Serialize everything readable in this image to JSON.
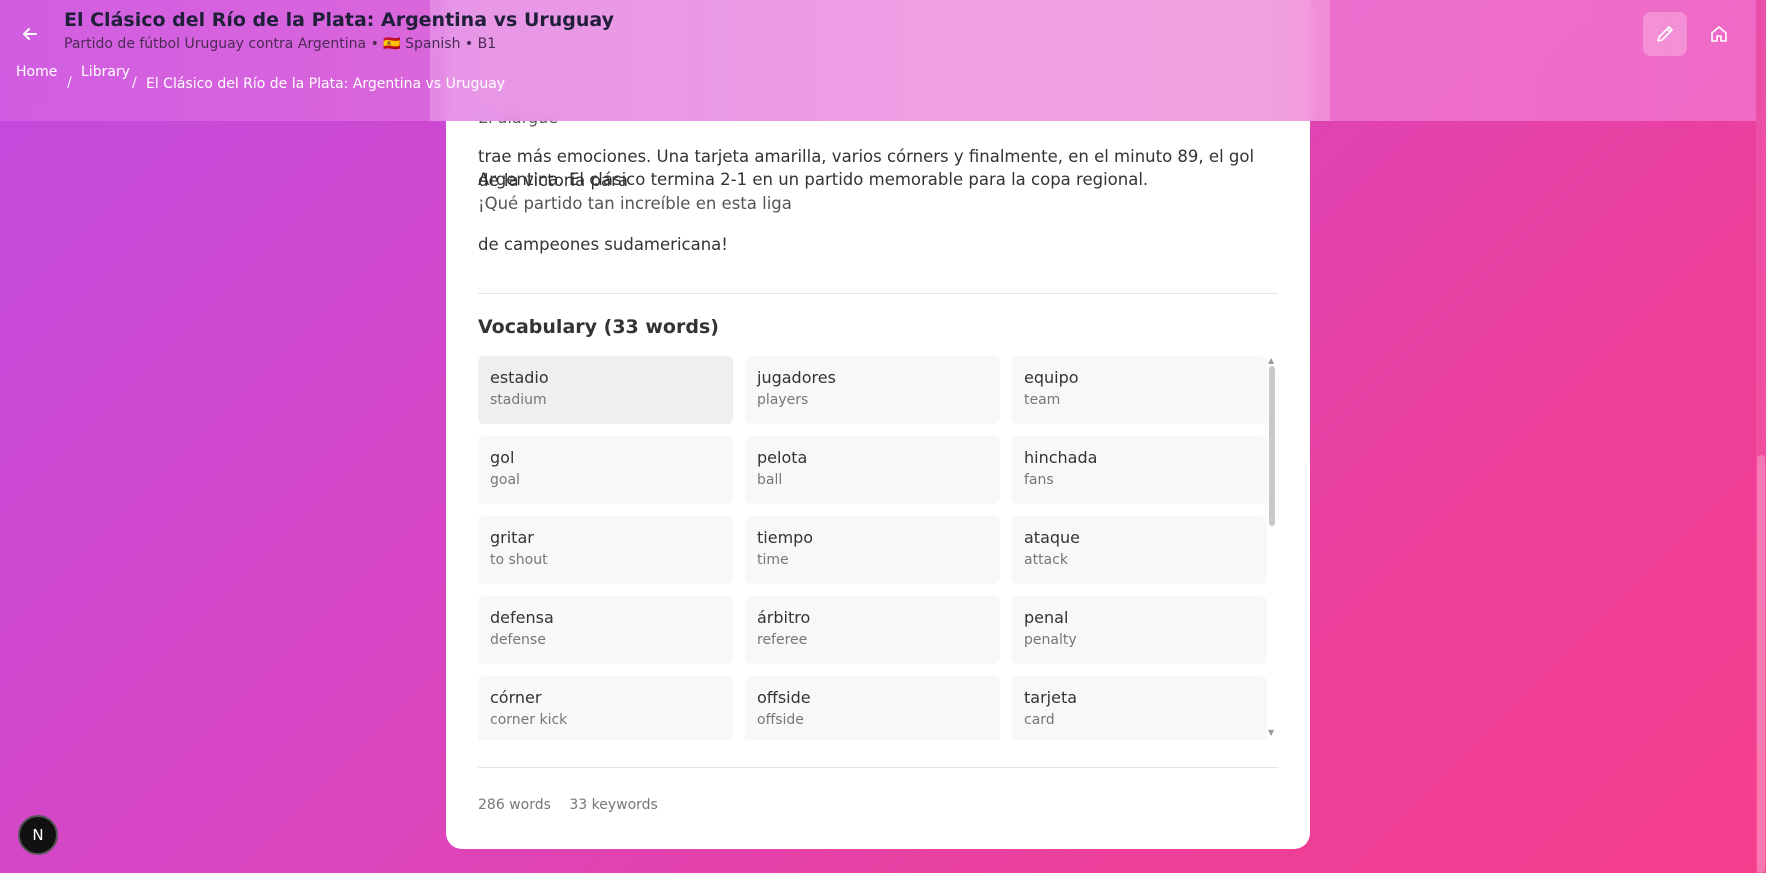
{
  "header": {
    "title": "El Clásico del Río de la Plata: Argentina vs Uruguay",
    "subtitle": "Partido de fútbol Uruguay contra Argentina • 🇪🇸 Spanish • B1",
    "breadcrumbs": [
      "Home",
      "Library",
      "El Clásico del Río de la Plata: Argentina vs Uruguay"
    ]
  },
  "story": {
    "partial_line": "El alargue",
    "paragraph1_line1": "trae más emociones. Una tarjeta amarilla, varios córners y finalmente, en el minuto 89, el gol de la victoria para",
    "paragraph1_line2": "Argentina. El clásico termina 2-1 en un partido memorable para la copa regional.",
    "paragraph1_line3": "¡Qué partido tan increíble en esta liga",
    "paragraph2": "de campeones sudamericana!"
  },
  "vocabulary": {
    "title": "Vocabulary (33 words)",
    "items": [
      {
        "word": "estadio",
        "translation": "stadium"
      },
      {
        "word": "jugadores",
        "translation": "players"
      },
      {
        "word": "equipo",
        "translation": "team"
      },
      {
        "word": "gol",
        "translation": "goal"
      },
      {
        "word": "pelota",
        "translation": "ball"
      },
      {
        "word": "hinchada",
        "translation": "fans"
      },
      {
        "word": "gritar",
        "translation": "to shout"
      },
      {
        "word": "tiempo",
        "translation": "time"
      },
      {
        "word": "ataque",
        "translation": "attack"
      },
      {
        "word": "defensa",
        "translation": "defense"
      },
      {
        "word": "árbitro",
        "translation": "referee"
      },
      {
        "word": "penal",
        "translation": "penalty"
      },
      {
        "word": "córner",
        "translation": "corner kick"
      },
      {
        "word": "offside",
        "translation": "offside"
      },
      {
        "word": "tarjeta",
        "translation": "card"
      }
    ]
  },
  "stats": {
    "words": "286 words",
    "keywords": "33 keywords"
  },
  "avatar": {
    "initial": "N"
  },
  "icons": {
    "back": "arrow-left-icon",
    "edit": "pencil-icon",
    "home": "home-icon"
  }
}
